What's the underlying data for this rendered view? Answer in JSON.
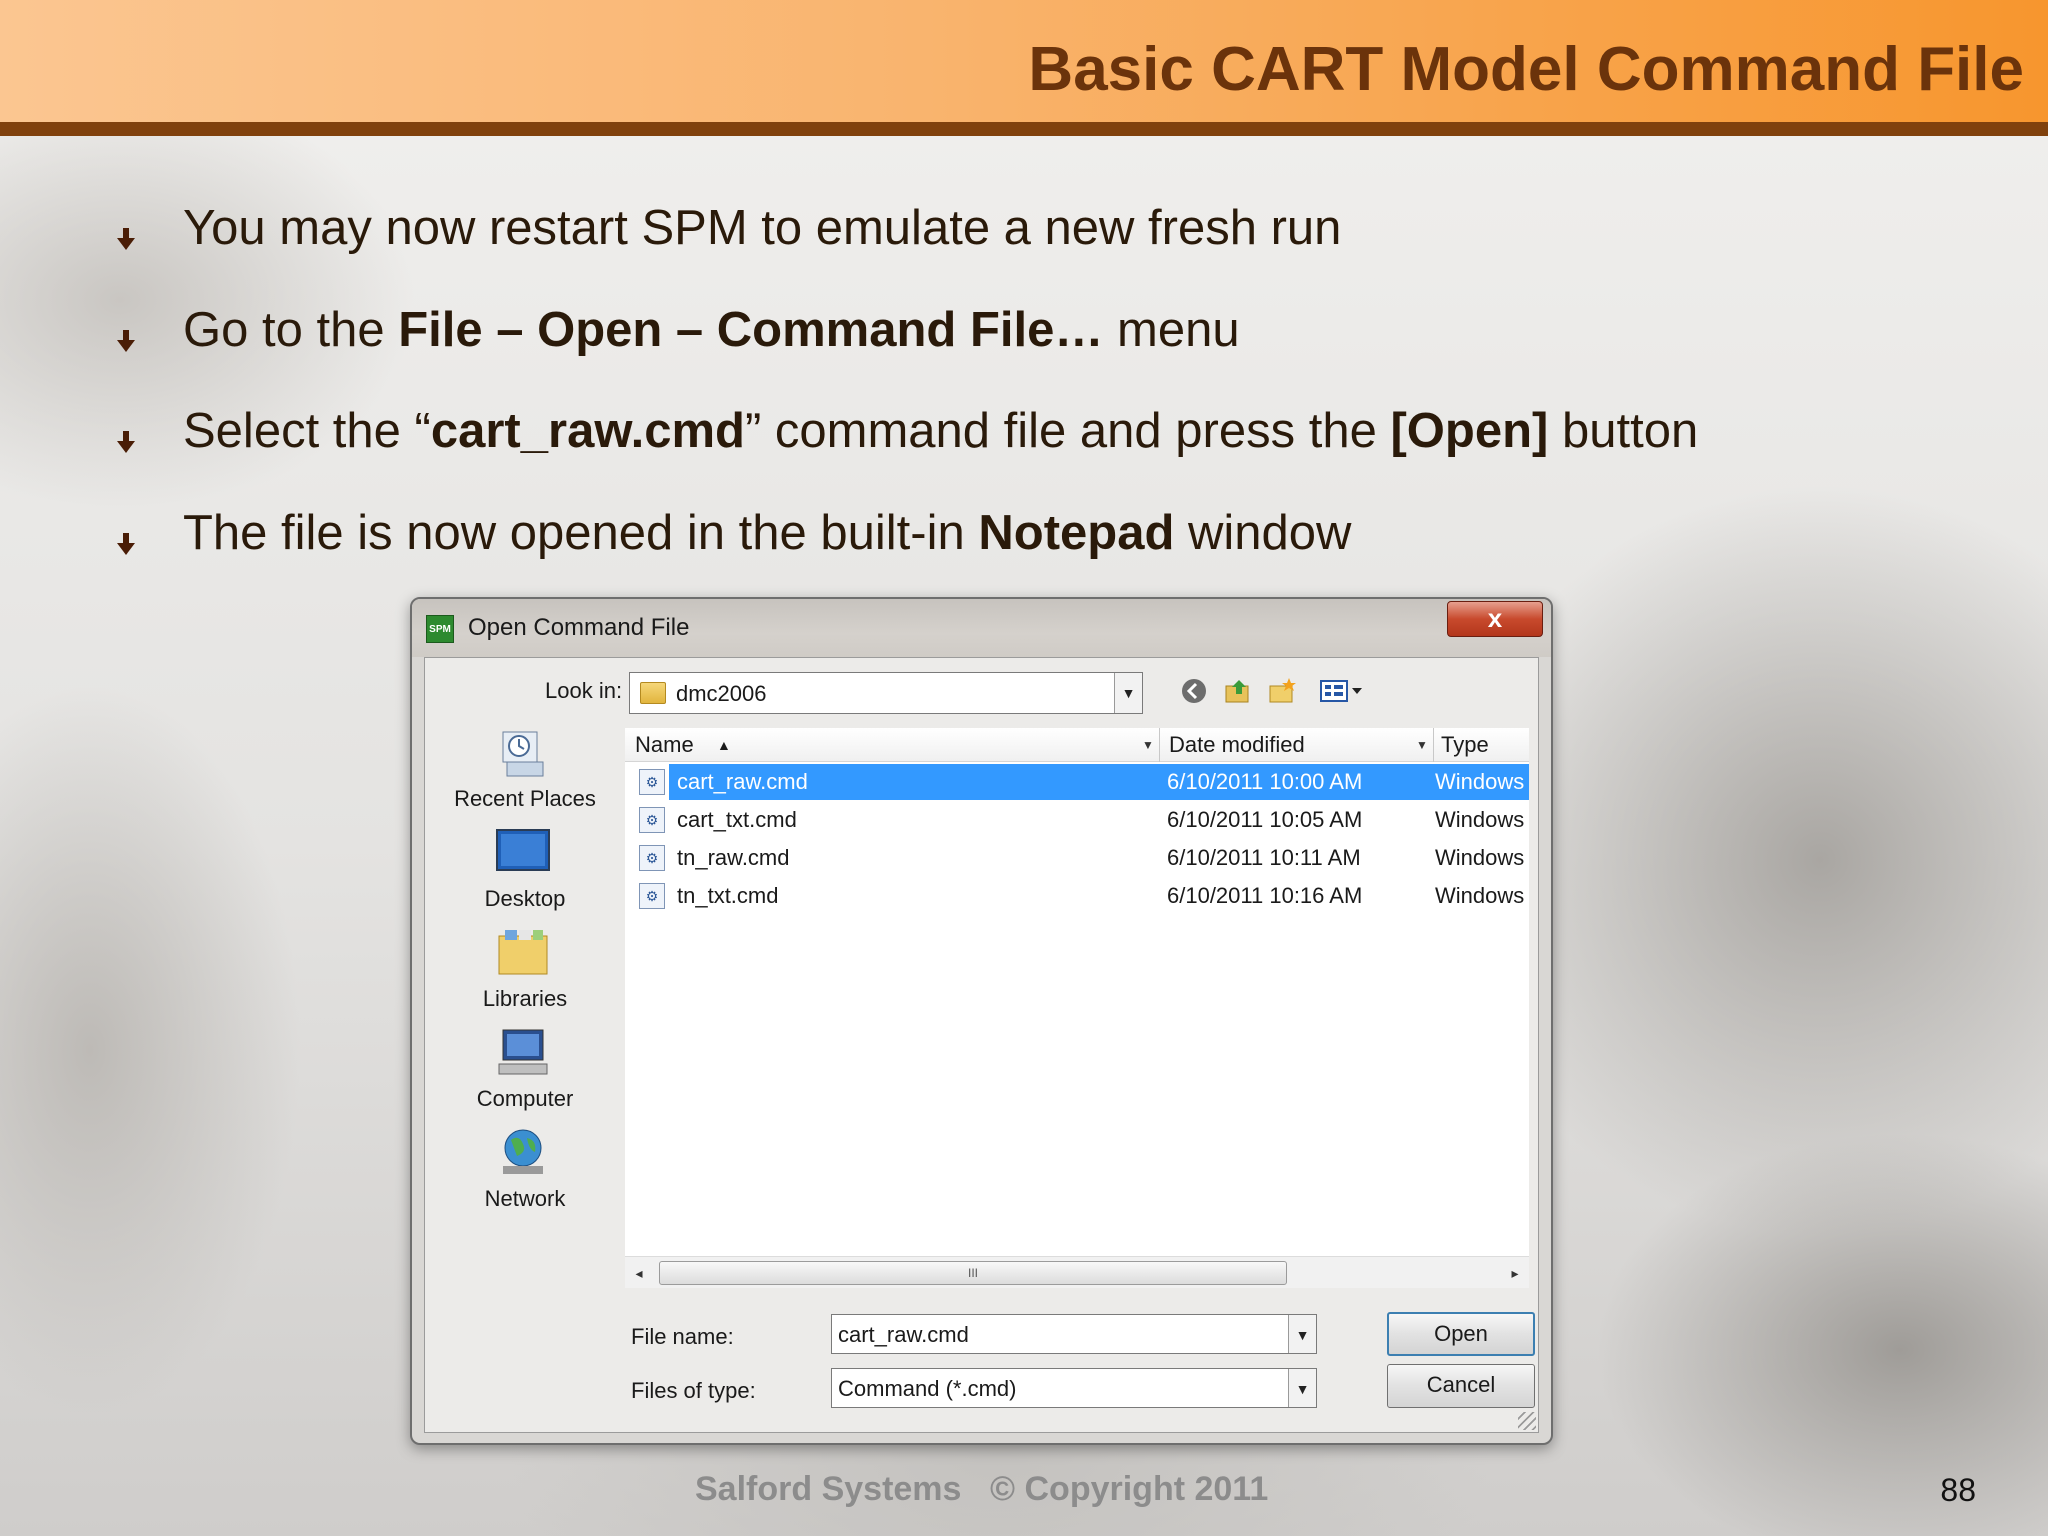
{
  "slide": {
    "title": "Basic CART Model Command File",
    "bullets": [
      {
        "parts": [
          {
            "text": "You may now restart SPM to emulate a new fresh run",
            "bold": false
          }
        ]
      },
      {
        "parts": [
          {
            "text": "Go to the ",
            "bold": false
          },
          {
            "text": "File – Open – Command File…",
            "bold": true
          },
          {
            "text": " menu",
            "bold": false
          }
        ]
      },
      {
        "parts": [
          {
            "text": "Select the “",
            "bold": false
          },
          {
            "text": "cart_raw.cmd",
            "bold": true
          },
          {
            "text": "” command file and press the ",
            "bold": false
          },
          {
            "text": "[Open]",
            "bold": true
          },
          {
            "text": " button",
            "bold": false
          }
        ]
      },
      {
        "parts": [
          {
            "text": "The file is now opened in the built-in ",
            "bold": false
          },
          {
            "text": "Notepad",
            "bold": true
          },
          {
            "text": " window",
            "bold": false
          }
        ]
      }
    ],
    "footer": {
      "company": "Salford Systems",
      "copyright": "© Copyright 2011",
      "page_number": "88"
    }
  },
  "dialog": {
    "app_icon_text": "SPM",
    "title": "Open Command File",
    "close_label": "x",
    "look_in_label": "Look in:",
    "look_in_value": "dmc2006",
    "toolbar_icons": [
      "back-icon",
      "up-folder-icon",
      "new-folder-icon",
      "views-menu-icon"
    ],
    "places": [
      {
        "label": "Recent Places",
        "icon": "recent-places-icon"
      },
      {
        "label": "Desktop",
        "icon": "desktop-icon"
      },
      {
        "label": "Libraries",
        "icon": "libraries-icon"
      },
      {
        "label": "Computer",
        "icon": "computer-icon"
      },
      {
        "label": "Network",
        "icon": "network-icon"
      }
    ],
    "columns": {
      "name": "Name",
      "date": "Date modified",
      "type": "Type"
    },
    "files": [
      {
        "name": "cart_raw.cmd",
        "date": "6/10/2011 10:00 AM",
        "type": "Windows",
        "selected": true
      },
      {
        "name": "cart_txt.cmd",
        "date": "6/10/2011 10:05 AM",
        "type": "Windows",
        "selected": false
      },
      {
        "name": "tn_raw.cmd",
        "date": "6/10/2011 10:11 AM",
        "type": "Windows",
        "selected": false
      },
      {
        "name": "tn_txt.cmd",
        "date": "6/10/2011 10:16 AM",
        "type": "Windows",
        "selected": false
      }
    ],
    "scroll_thumb_text": "III",
    "file_name_label": "File name:",
    "file_name_value": "cart_raw.cmd",
    "file_type_label": "Files of type:",
    "file_type_value": "Command (*.cmd)",
    "open_label": "Open",
    "cancel_label": "Cancel"
  },
  "colors": {
    "header_start": "#fbc691",
    "header_end": "#f7962e",
    "header_rule": "#80410d",
    "title_text": "#6b330b",
    "selection": "#3399ff"
  }
}
